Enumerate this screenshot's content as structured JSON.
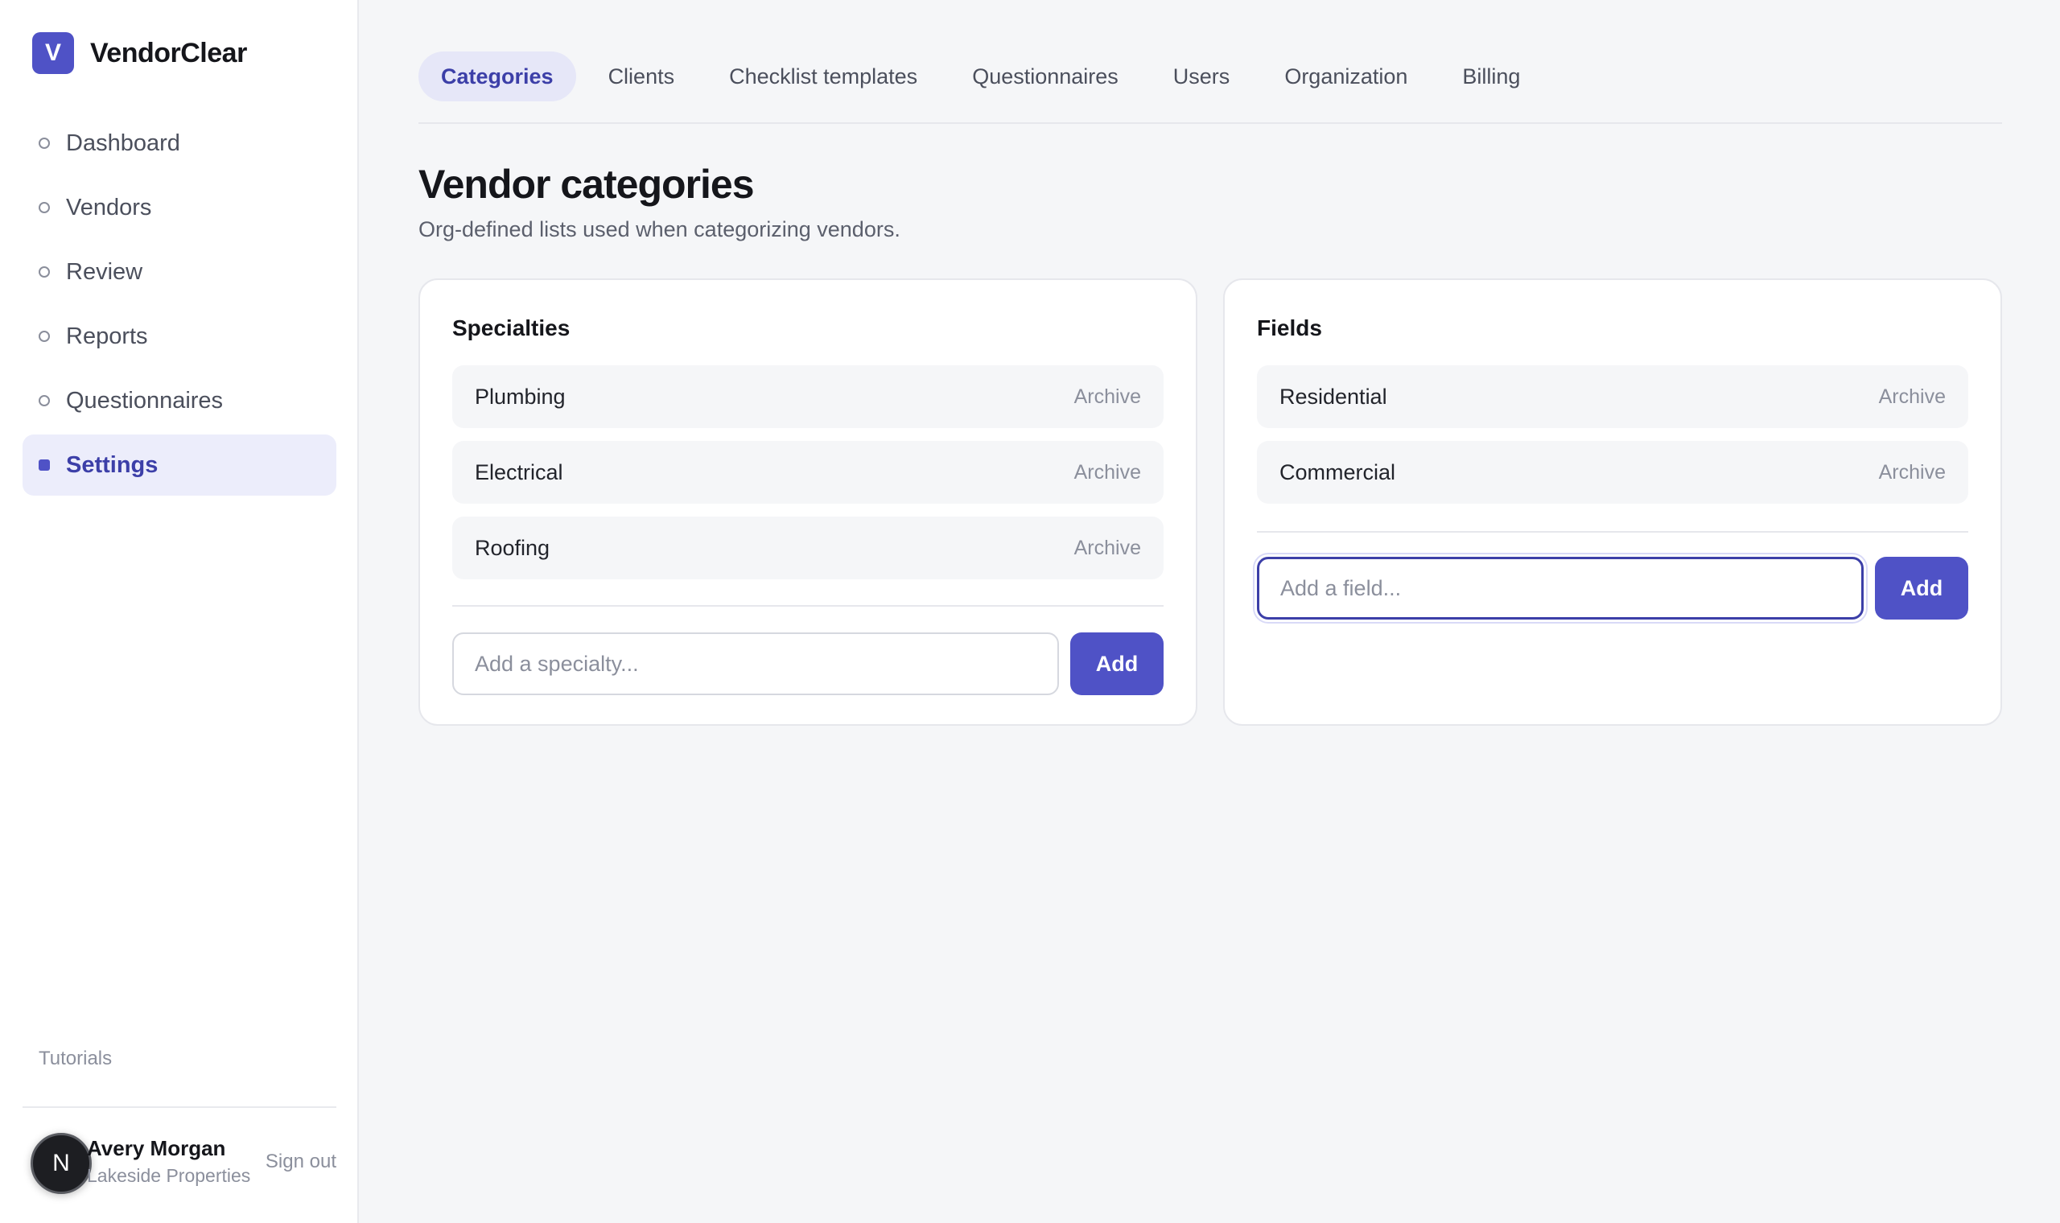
{
  "brand": {
    "logo_letter": "V",
    "name": "VendorClear",
    "accent": "#4f52c6"
  },
  "nav": {
    "items": [
      {
        "label": "Dashboard"
      },
      {
        "label": "Vendors"
      },
      {
        "label": "Review"
      },
      {
        "label": "Reports"
      },
      {
        "label": "Questionnaires"
      },
      {
        "label": "Settings",
        "active": true
      }
    ]
  },
  "sidebar_footer": {
    "tutorials": "Tutorials",
    "user": {
      "avatar_letter": "N",
      "name": "Avery Morgan",
      "org": "Lakeside Properties"
    },
    "sign_out": "Sign out"
  },
  "tabs": [
    {
      "label": "Categories",
      "active": true
    },
    {
      "label": "Clients"
    },
    {
      "label": "Checklist templates"
    },
    {
      "label": "Questionnaires"
    },
    {
      "label": "Users"
    },
    {
      "label": "Organization"
    },
    {
      "label": "Billing"
    }
  ],
  "page": {
    "title": "Vendor categories",
    "subtitle": "Org-defined lists used when categorizing vendors."
  },
  "specialties": {
    "title": "Specialties",
    "items": [
      {
        "label": "Plumbing",
        "action": "Archive"
      },
      {
        "label": "Electrical",
        "action": "Archive"
      },
      {
        "label": "Roofing",
        "action": "Archive"
      }
    ],
    "input_placeholder": "Add a specialty...",
    "add_label": "Add"
  },
  "fields": {
    "title": "Fields",
    "items": [
      {
        "label": "Residential",
        "action": "Archive"
      },
      {
        "label": "Commercial",
        "action": "Archive"
      }
    ],
    "input_placeholder": "Add a field...",
    "add_label": "Add"
  }
}
